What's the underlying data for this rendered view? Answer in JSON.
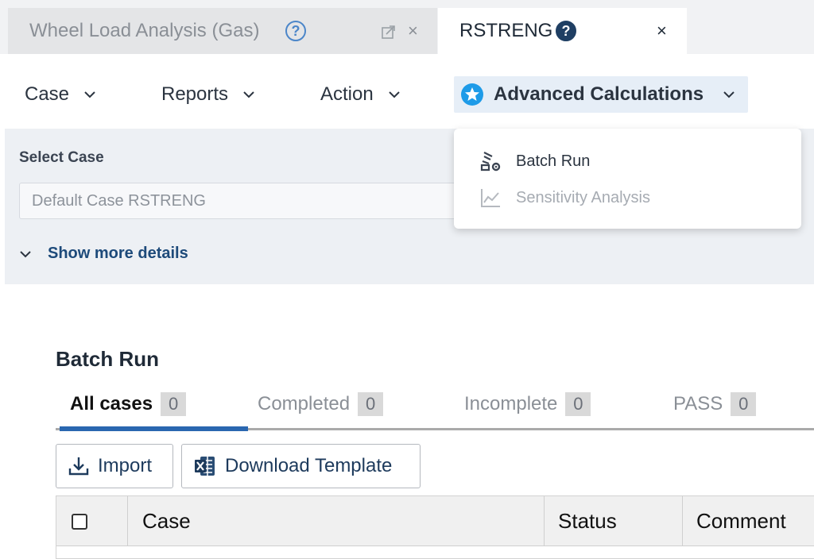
{
  "tabs": [
    {
      "title": "Wheel Load Analysis (Gas)",
      "help": "?",
      "close": "×",
      "popout_icon": "popout-icon"
    },
    {
      "title": "RSTRENG",
      "help": "?",
      "close": "×"
    }
  ],
  "menu": {
    "case": "Case",
    "reports": "Reports",
    "action": "Action",
    "advanced": "Advanced Calculations"
  },
  "select_case": {
    "label": "Select Case",
    "value": "Default Case RSTRENG",
    "more_details": "Show more details"
  },
  "dropdown": {
    "items": [
      {
        "label": "Batch Run",
        "icon": "batch-run-icon",
        "enabled": true
      },
      {
        "label": "Sensitivity Analysis",
        "icon": "line-chart-icon",
        "enabled": false
      }
    ]
  },
  "batch_run": {
    "title": "Batch Run",
    "filters": [
      {
        "label": "All cases",
        "count": "0"
      },
      {
        "label": "Completed",
        "count": "0"
      },
      {
        "label": "Incomplete",
        "count": "0"
      },
      {
        "label": "PASS",
        "count": "0"
      }
    ],
    "import_label": "Import",
    "download_label": "Download Template",
    "table": {
      "columns": [
        "Case",
        "Status",
        "Comment"
      ]
    }
  },
  "colors": {
    "accent": "#2a67b0",
    "star": "#1e9be8",
    "link": "#1d4a7a"
  }
}
